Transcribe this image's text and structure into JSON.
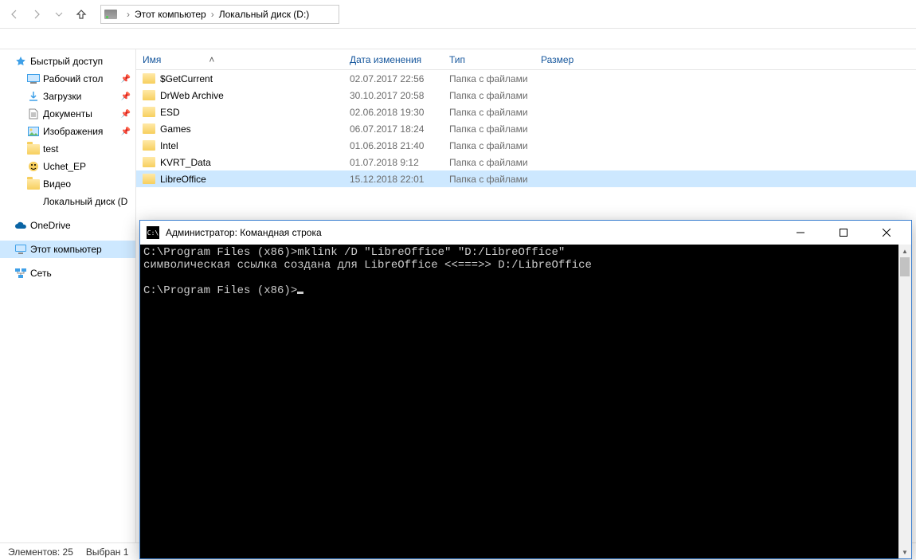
{
  "nav": {
    "breadcrumb": [
      "Этот компьютер",
      "Локальный диск (D:)"
    ]
  },
  "sidebar": {
    "quick": {
      "label": "Быстрый доступ"
    },
    "quick_items": [
      {
        "label": "Рабочий стол",
        "pinned": true,
        "icon": "desktop"
      },
      {
        "label": "Загрузки",
        "pinned": true,
        "icon": "download"
      },
      {
        "label": "Документы",
        "pinned": true,
        "icon": "document"
      },
      {
        "label": "Изображения",
        "pinned": true,
        "icon": "picture"
      },
      {
        "label": "test",
        "pinned": false,
        "icon": "folder"
      },
      {
        "label": "Uchet_EP",
        "pinned": false,
        "icon": "app"
      },
      {
        "label": "Видео",
        "pinned": false,
        "icon": "folder"
      },
      {
        "label": "Локальный диск (D",
        "pinned": false,
        "icon": "drive"
      }
    ],
    "onedrive": {
      "label": "OneDrive"
    },
    "thispc": {
      "label": "Этот компьютер"
    },
    "network": {
      "label": "Сеть"
    }
  },
  "columns": {
    "name": "Имя",
    "date": "Дата изменения",
    "type": "Тип",
    "size": "Размер"
  },
  "files": [
    {
      "name": "$GetCurrent",
      "date": "02.07.2017 22:56",
      "type": "Папка с файлами",
      "sel": false
    },
    {
      "name": "DrWeb Archive",
      "date": "30.10.2017 20:58",
      "type": "Папка с файлами",
      "sel": false
    },
    {
      "name": "ESD",
      "date": "02.06.2018 19:30",
      "type": "Папка с файлами",
      "sel": false
    },
    {
      "name": "Games",
      "date": "06.07.2017 18:24",
      "type": "Папка с файлами",
      "sel": false
    },
    {
      "name": "Intel",
      "date": "01.06.2018 21:40",
      "type": "Папка с файлами",
      "sel": false
    },
    {
      "name": "KVRT_Data",
      "date": "01.07.2018 9:12",
      "type": "Папка с файлами",
      "sel": false
    },
    {
      "name": "LibreOffice",
      "date": "15.12.2018 22:01",
      "type": "Папка с файлами",
      "sel": true
    }
  ],
  "status": {
    "items": "Элементов: 25",
    "selected": "Выбран 1"
  },
  "cmd": {
    "title": "Администратор: Командная строка",
    "lines": [
      "C:\\Program Files (x86)>mklink /D \"LibreOffice\" \"D:/LibreOffice\"",
      "символическая ссылка создана для LibreOffice <<===>> D:/LibreOffice",
      "",
      "C:\\Program Files (x86)>"
    ]
  }
}
